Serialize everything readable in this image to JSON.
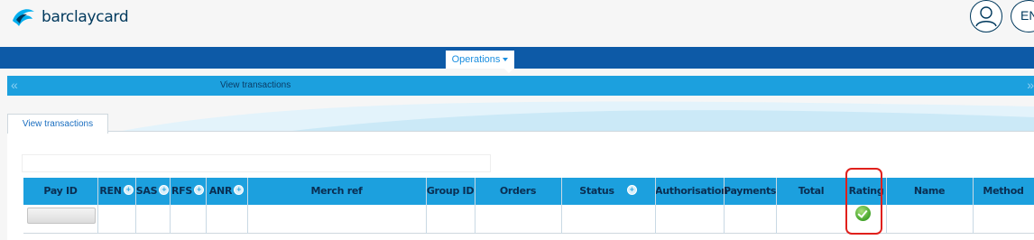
{
  "header": {
    "brand": "barclaycard",
    "language": "EN"
  },
  "nav": {
    "menu_label": "Operations"
  },
  "breadcrumb": {
    "prev": "«",
    "title": "View transactions",
    "next": "»"
  },
  "tabs": [
    {
      "label": "View transactions",
      "active": true
    }
  ],
  "table": {
    "columns": [
      "Pay ID",
      "REN",
      "SAS",
      "RFS",
      "ANR",
      "Merch ref",
      "Group ID",
      "Orders",
      "Status",
      "Authorisation",
      "Payments",
      "Total",
      "Rating",
      "Name",
      "Method"
    ],
    "rows": [
      {
        "rating": "ok"
      }
    ]
  },
  "colors": {
    "header_bar": "#0d5aa7",
    "accent": "#1ca0de",
    "highlight": "#e0201c",
    "rating_ok": "#43a32a"
  }
}
